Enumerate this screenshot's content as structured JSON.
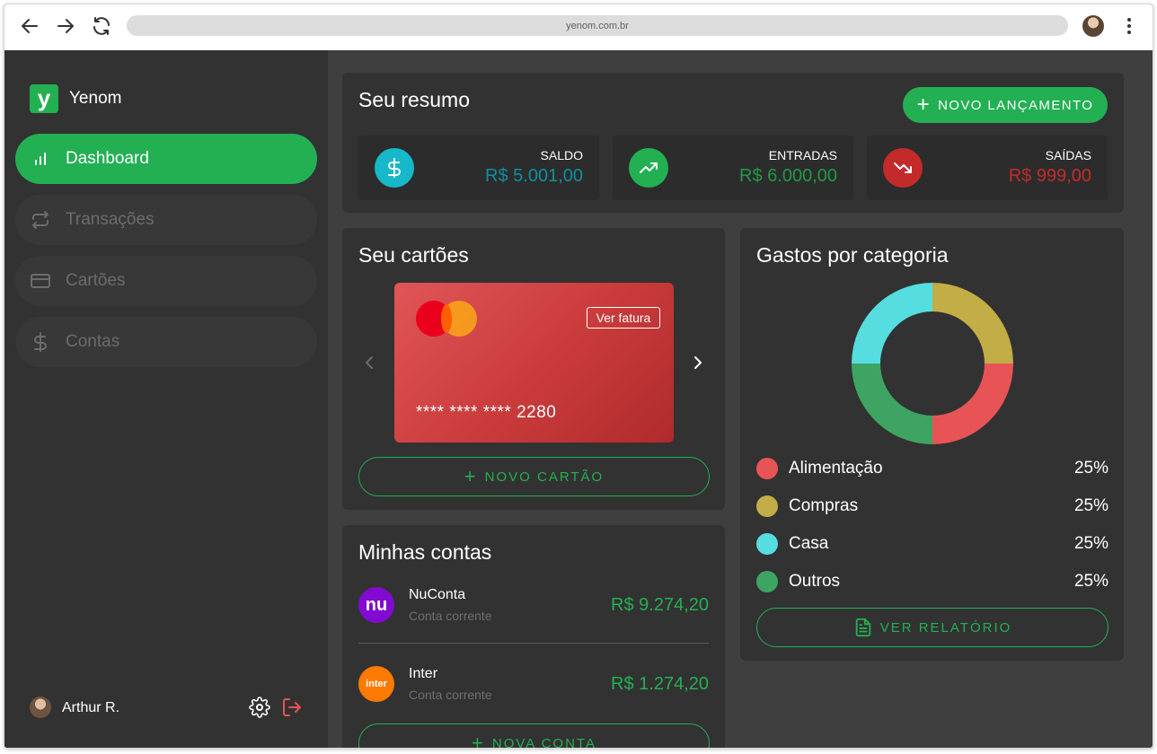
{
  "browser": {
    "url": "yenom.com.br"
  },
  "sidebar": {
    "logo_letter": "y",
    "app_name": "Yenom",
    "items": [
      {
        "label": "Dashboard",
        "icon": "bar-chart-icon",
        "active": true
      },
      {
        "label": "Transações",
        "icon": "swap-icon",
        "active": false
      },
      {
        "label": "Cartões",
        "icon": "credit-card-icon",
        "active": false
      },
      {
        "label": "Contas",
        "icon": "dollar-icon",
        "active": false
      }
    ],
    "user_name": "Arthur R."
  },
  "resumo": {
    "title": "Seu resumo",
    "new_button": "NOVO LANÇAMENTO",
    "stats": [
      {
        "label": "SALDO",
        "value": "R$ 5.001,00",
        "color": "#0e8fa3",
        "icon_bg": "#16b8c9"
      },
      {
        "label": "ENTRADAS",
        "value": "R$ 6.000,00",
        "color": "#1f9a48",
        "icon_bg": "#23b053"
      },
      {
        "label": "SAÍDAS",
        "value": "R$ 999,00",
        "color": "#c32b2b",
        "icon_bg": "#c32b2b"
      }
    ]
  },
  "cartoes": {
    "title": "Seu cartões",
    "card_number": "**** **** **** 2280",
    "ver_fatura": "Ver fatura",
    "new_button": "NOVO CARTÃO"
  },
  "contas": {
    "title": "Minhas contas",
    "accounts": [
      {
        "name": "NuConta",
        "type": "Conta corrente",
        "value": "R$ 9.274,20",
        "logo_text": "nu",
        "logo_color": "#820ad1"
      },
      {
        "name": "Inter",
        "type": "Conta corrente",
        "value": "R$ 1.274,20",
        "logo_text": "inter",
        "logo_color": "#ff7a00"
      }
    ],
    "new_button": "NOVA CONTA"
  },
  "gastos": {
    "title": "Gastos por categoria",
    "categories": [
      {
        "label": "Alimentação",
        "percent": "25%",
        "value": 25,
        "color": "#e85456"
      },
      {
        "label": "Compras",
        "percent": "25%",
        "value": 25,
        "color": "#c2ad47"
      },
      {
        "label": "Casa",
        "percent": "25%",
        "value": 25,
        "color": "#56dde0"
      },
      {
        "label": "Outros",
        "percent": "25%",
        "value": 25,
        "color": "#3ea463"
      }
    ],
    "report_button": "VER RELATÓRIO"
  },
  "colors": {
    "accent": "#23b053",
    "sidebar_bg": "#323232",
    "content_bg": "#3f3f3f"
  }
}
